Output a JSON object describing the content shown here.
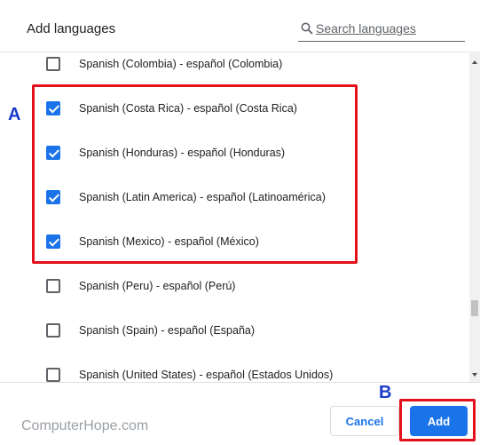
{
  "dialog": {
    "title": "Add languages",
    "search_label": "Search languages"
  },
  "languages": [
    {
      "label": "Spanish (Colombia) - español (Colombia)",
      "checked": false
    },
    {
      "label": "Spanish (Costa Rica) - español (Costa Rica)",
      "checked": true
    },
    {
      "label": "Spanish (Honduras) - español (Honduras)",
      "checked": true
    },
    {
      "label": "Spanish (Latin America) - español (Latinoamérica)",
      "checked": true
    },
    {
      "label": "Spanish (Mexico) - español (México)",
      "checked": true
    },
    {
      "label": "Spanish (Peru) - español (Perú)",
      "checked": false
    },
    {
      "label": "Spanish (Spain) - español (España)",
      "checked": false
    },
    {
      "label": "Spanish (United States) - español (Estados Unidos)",
      "checked": false
    }
  ],
  "footer": {
    "watermark": "ComputerHope.com",
    "cancel_label": "Cancel",
    "add_label": "Add"
  },
  "annotations": {
    "a_label": "A",
    "b_label": "B"
  },
  "colors": {
    "accent": "#1a73e8",
    "annotation_box": "#e2101a",
    "annotation_text": "#1a3cc8"
  }
}
